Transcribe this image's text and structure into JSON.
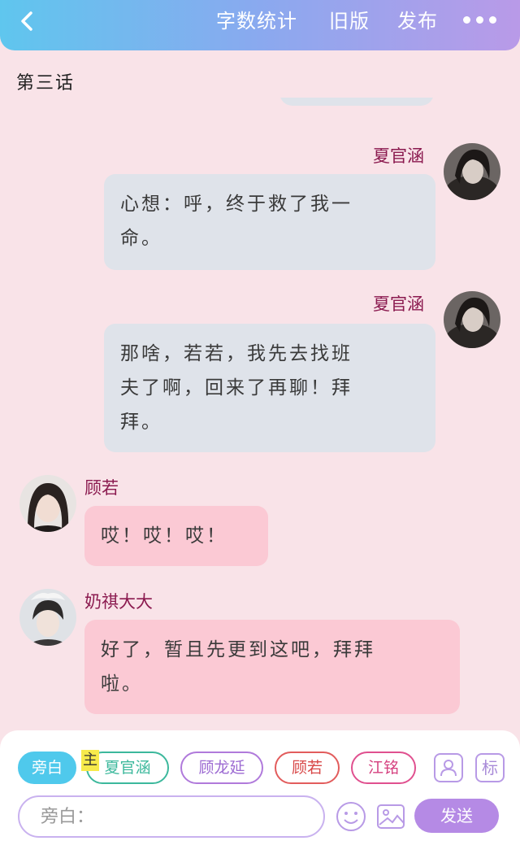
{
  "header": {
    "nav_stats": "字数统计",
    "nav_old": "旧版",
    "nav_publish": "发布"
  },
  "chapter": {
    "title": "第三话"
  },
  "messages": [
    {
      "side": "right",
      "sender": "夏官涵",
      "lines": [
        "心想：呼，终于救了我一",
        "命。"
      ]
    },
    {
      "side": "right",
      "sender": "夏官涵",
      "lines": [
        "那啥，若若，我先去找班",
        "夫了啊，回来了再聊！拜",
        "拜。"
      ]
    },
    {
      "side": "left",
      "sender": "顾若",
      "lines": [
        "哎！哎！哎！"
      ]
    },
    {
      "side": "left",
      "sender": "奶祺大大",
      "lines": [
        "好了，暂且先更到这吧，拜拜",
        "啦。"
      ]
    }
  ],
  "roles": {
    "narration": "旁白",
    "main_tag": "主",
    "xia": "夏官涵",
    "gulong": "顾龙延",
    "guruo": "顾若",
    "jiangming": "江铭"
  },
  "composer": {
    "placeholder": "旁白：",
    "send_label": "发送",
    "tag_icon_text": "标"
  },
  "colors": {
    "accent": "#b58ae5",
    "left_bubble": "#fbc9d4",
    "right_bubble": "#dfe3ea",
    "sender_name": "#8b1a4f"
  }
}
